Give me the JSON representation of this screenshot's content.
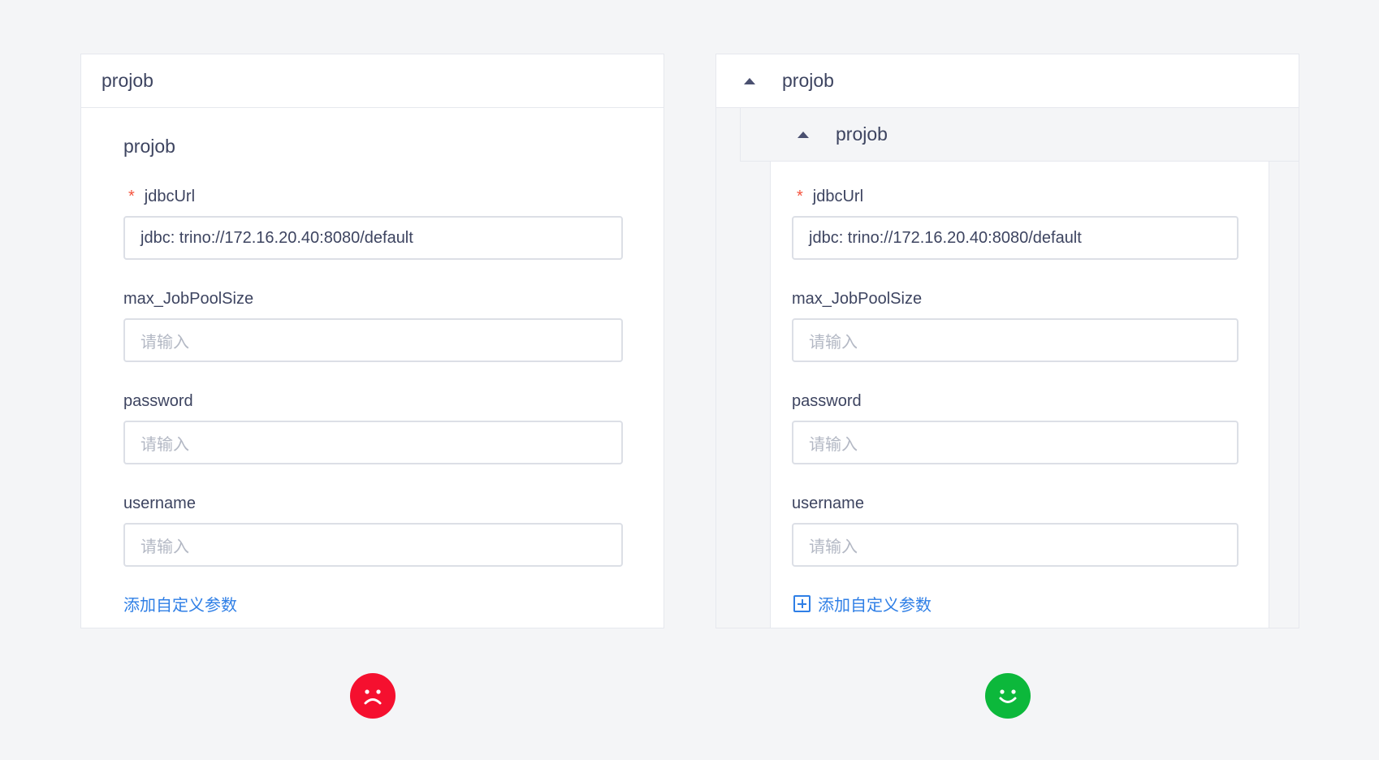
{
  "left_panel": {
    "header_title": "projob",
    "section_title": "projob",
    "fields": [
      {
        "label": "jdbcUrl",
        "required": true,
        "value": "jdbc: trino://172.16.20.40:8080/default",
        "placeholder": ""
      },
      {
        "label": "max_JobPoolSize",
        "required": false,
        "value": "",
        "placeholder": "请输入"
      },
      {
        "label": "password",
        "required": false,
        "value": "",
        "placeholder": "请输入"
      },
      {
        "label": "username",
        "required": false,
        "value": "",
        "placeholder": "请输入"
      }
    ],
    "add_link": "添加自定义参数",
    "verdict_icon": "sad-face-icon"
  },
  "right_panel": {
    "header_title": "projob",
    "sub_header_title": "projob",
    "fields": [
      {
        "label": "jdbcUrl",
        "required": true,
        "value": "jdbc: trino://172.16.20.40:8080/default",
        "placeholder": ""
      },
      {
        "label": "max_JobPoolSize",
        "required": false,
        "value": "",
        "placeholder": "请输入"
      },
      {
        "label": "password",
        "required": false,
        "value": "",
        "placeholder": "请输入"
      },
      {
        "label": "username",
        "required": false,
        "value": "",
        "placeholder": "请输入"
      }
    ],
    "add_link": "添加自定义参数",
    "add_icon": "plus-square-icon",
    "verdict_icon": "happy-face-icon"
  },
  "colors": {
    "bad": "#f5102f",
    "good": "#0cb83b",
    "link": "#2f7fe6",
    "required_star": "#f5533d"
  }
}
